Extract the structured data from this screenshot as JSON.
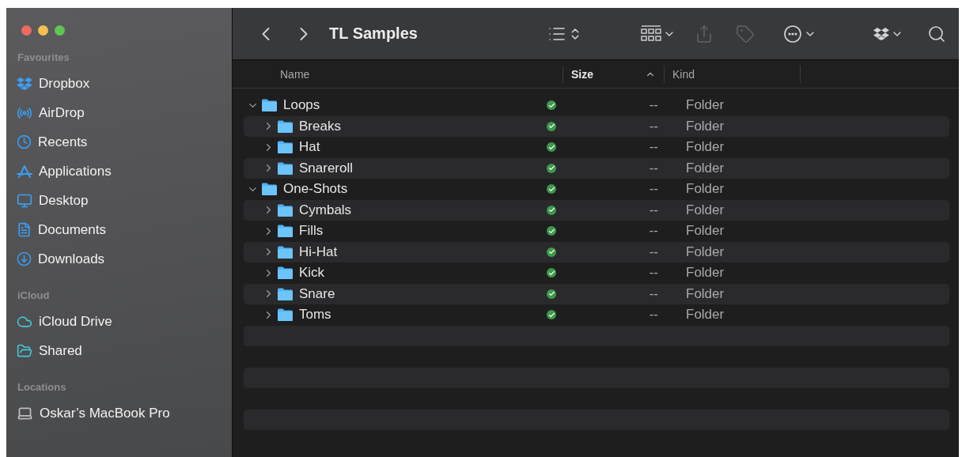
{
  "window": {
    "title": "TL Samples",
    "traffic_lights": [
      {
        "color": "#ed6a5e"
      },
      {
        "color": "#f5bf4f"
      },
      {
        "color": "#61c554"
      }
    ]
  },
  "sidebar": {
    "sections": [
      {
        "title": "Favourites",
        "items": [
          {
            "kind": "dropbox",
            "label": "Dropbox"
          },
          {
            "kind": "airdrop",
            "label": "AirDrop"
          },
          {
            "kind": "recents",
            "label": "Recents"
          },
          {
            "kind": "applications",
            "label": "Applications"
          },
          {
            "kind": "desktop",
            "label": "Desktop"
          },
          {
            "kind": "documents",
            "label": "Documents"
          },
          {
            "kind": "downloads",
            "label": "Downloads"
          }
        ]
      },
      {
        "title": "iCloud",
        "items": [
          {
            "kind": "icloud",
            "label": "iCloud Drive"
          },
          {
            "kind": "shared",
            "label": "Shared"
          }
        ]
      },
      {
        "title": "Locations",
        "items": [
          {
            "kind": "laptop",
            "label": "Oskar’s MacBook Pro"
          }
        ]
      }
    ]
  },
  "toolbar": {
    "items": [
      {
        "kind": "back",
        "disabled": false
      },
      {
        "kind": "forward",
        "disabled": false
      },
      {
        "kind": "title"
      },
      {
        "kind": "list-view",
        "disabled": false
      },
      {
        "kind": "group",
        "disabled": false
      },
      {
        "kind": "share",
        "disabled": true
      },
      {
        "kind": "tag",
        "disabled": true
      },
      {
        "kind": "more",
        "disabled": false
      },
      {
        "kind": "dropbox",
        "disabled": false
      },
      {
        "kind": "search",
        "disabled": false
      }
    ]
  },
  "table": {
    "columns": [
      {
        "label": "Name",
        "selected": false
      },
      {
        "label": "Size",
        "selected": true
      },
      {
        "label": "Kind",
        "selected": false
      }
    ],
    "rows": [
      {
        "name": "Loops",
        "synced": true,
        "size": "--",
        "kind": "Folder",
        "expanded": true,
        "children": [
          {
            "name": "Breaks",
            "synced": true,
            "size": "--",
            "kind": "Folder",
            "expanded": false
          },
          {
            "name": "Hat",
            "synced": true,
            "size": "--",
            "kind": "Folder",
            "expanded": false
          },
          {
            "name": "Snareroll",
            "synced": true,
            "size": "--",
            "kind": "Folder",
            "expanded": false
          }
        ]
      },
      {
        "name": "One-Shots",
        "synced": true,
        "size": "--",
        "kind": "Folder",
        "expanded": true,
        "children": [
          {
            "name": "Cymbals",
            "synced": true,
            "size": "--",
            "kind": "Folder",
            "expanded": false
          },
          {
            "name": "Fills",
            "synced": true,
            "size": "--",
            "kind": "Folder",
            "expanded": false
          },
          {
            "name": "Hi-Hat",
            "synced": true,
            "size": "--",
            "kind": "Folder",
            "expanded": false
          },
          {
            "name": "Kick",
            "synced": true,
            "size": "--",
            "kind": "Folder",
            "expanded": false
          },
          {
            "name": "Snare",
            "synced": true,
            "size": "--",
            "kind": "Folder",
            "expanded": false
          },
          {
            "name": "Toms",
            "synced": true,
            "size": "--",
            "kind": "Folder",
            "expanded": false
          }
        ]
      }
    ]
  }
}
